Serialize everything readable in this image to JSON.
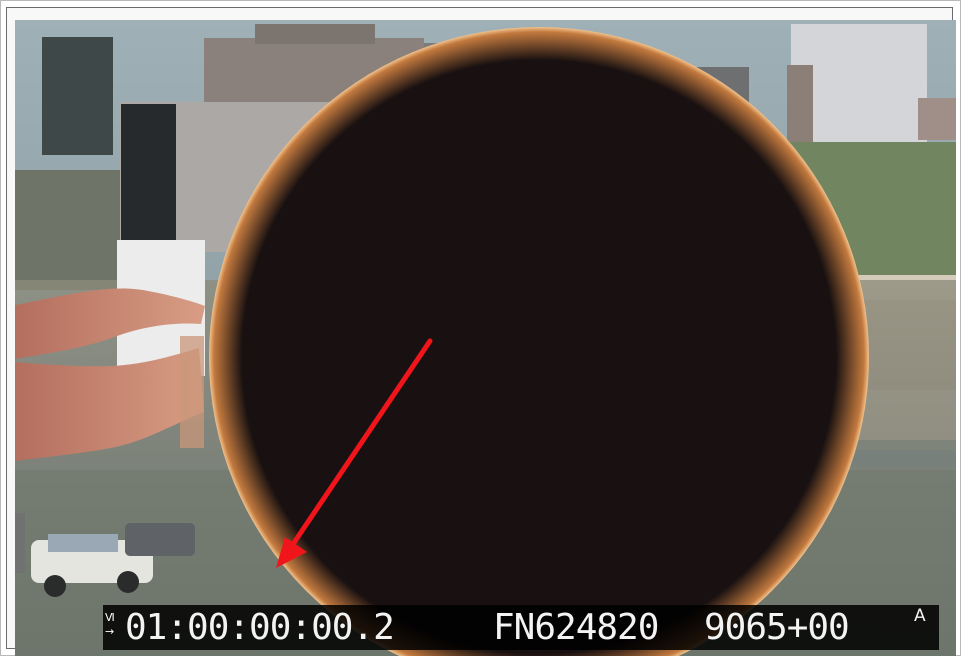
{
  "overlay": {
    "prefix_top": "VI",
    "prefix_bottom": "→",
    "timecode": "01:00:00:00.2",
    "frame_number": "FN624820",
    "code": "9065+00",
    "suffix": "A"
  },
  "colors": {
    "disk": "#110c0b",
    "arrow": "#f0151b",
    "overlay_background": "#000000",
    "overlay_text": "#f3f3f3"
  },
  "icons": {
    "annotation": "red-arrow-icon"
  }
}
